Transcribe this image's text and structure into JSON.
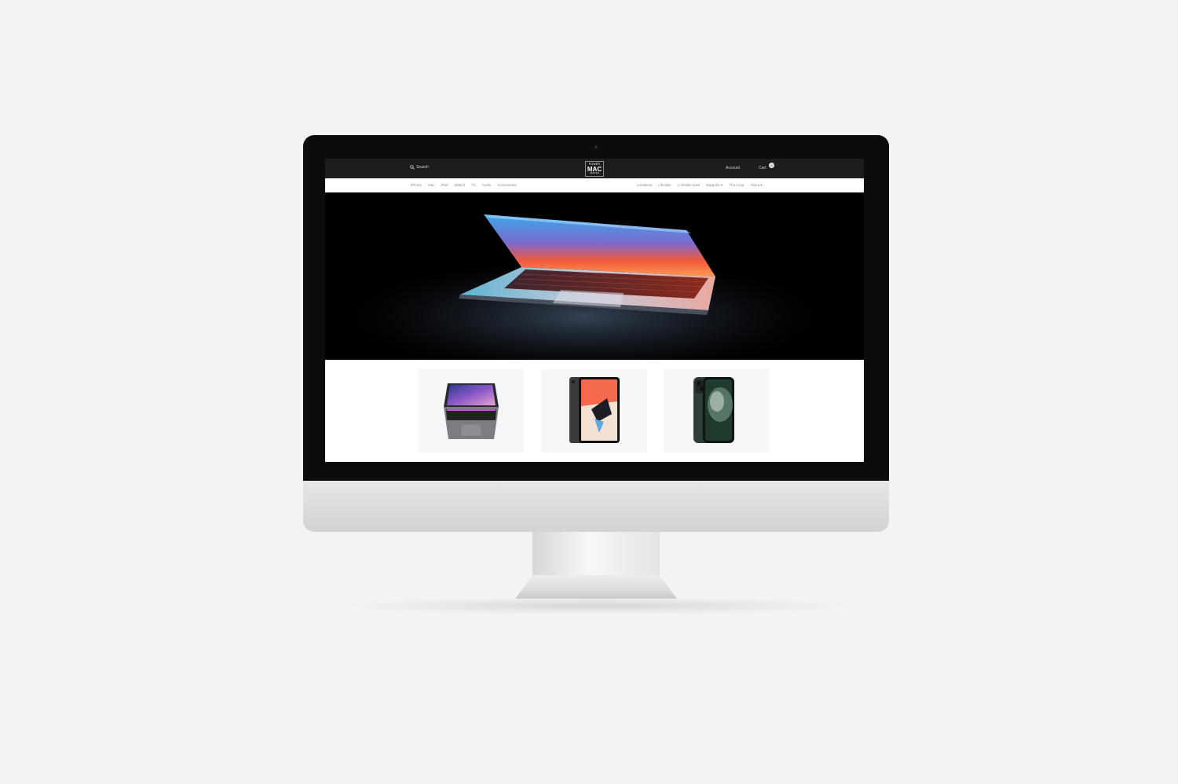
{
  "header": {
    "search_label": "Search",
    "logo": {
      "line1": "POWER",
      "line2": "MAC",
      "line3": "CENTER"
    },
    "account_label": "Account",
    "cart_label": "Cart",
    "cart_count": "0"
  },
  "nav": {
    "left": [
      "iPhone",
      "Mac",
      "iPad",
      "iWatch",
      "TV",
      "Audio",
      "Accessories"
    ],
    "right": [
      "Locations",
      "Lifestyle",
      "1 Infinite Card",
      "Supports ▾",
      "The Loop",
      "About ▾"
    ]
  },
  "colors": {
    "topbar": "#1d1d1d",
    "nav_text": "#8a8a8a",
    "card_bg": "#f5f6f7",
    "page_bg": "#f3f3f3"
  },
  "products": [
    {
      "icon": "macbook-pro-icon"
    },
    {
      "icon": "ipad-pro-icon"
    },
    {
      "icon": "iphone-11-pro-icon"
    }
  ]
}
